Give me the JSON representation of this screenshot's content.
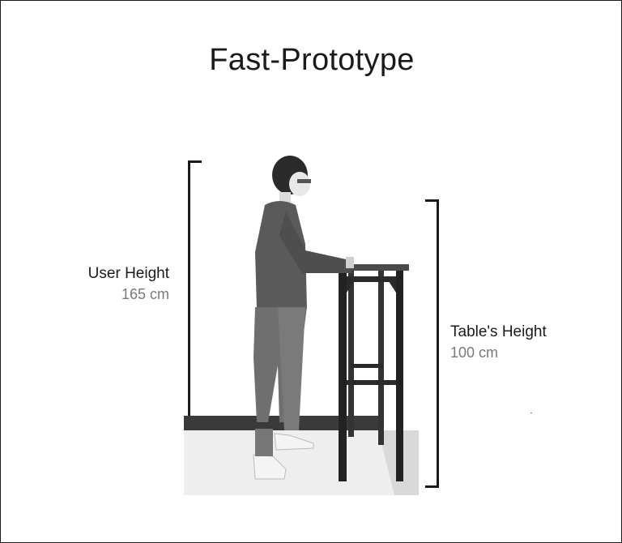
{
  "title": "Fast-Prototype",
  "user_label": {
    "name": "User Height",
    "value": "165 cm"
  },
  "table_label": {
    "name": "Table's Height",
    "value": "100 cm"
  },
  "colors": {
    "ink": "#1a1a1a",
    "value_grey": "#7a7a7a",
    "background": "#ffffff"
  }
}
